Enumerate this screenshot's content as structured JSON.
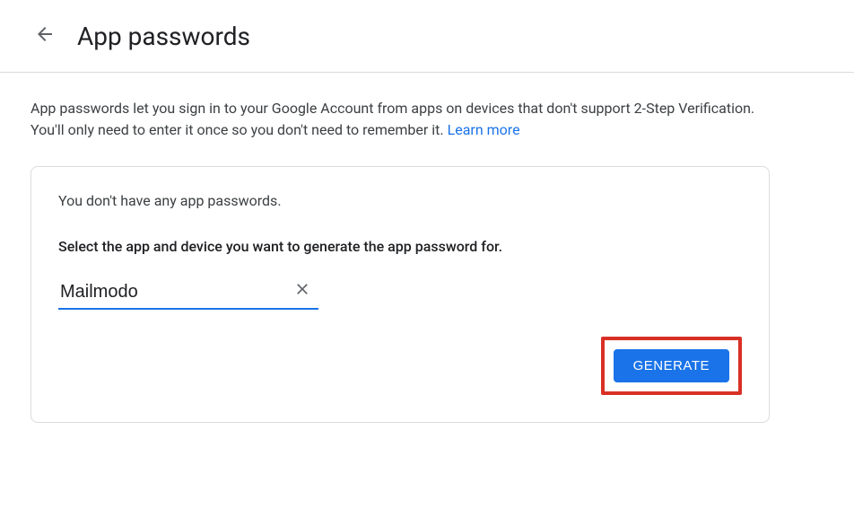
{
  "header": {
    "title": "App passwords"
  },
  "description": {
    "text": "App passwords let you sign in to your Google Account from apps on devices that don't support 2-Step Verification. You'll only need to enter it once so you don't need to remember it. ",
    "learn_more": "Learn more"
  },
  "card": {
    "empty_message": "You don't have any app passwords.",
    "select_message": "Select the app and device you want to generate the app password for.",
    "input_value": "Mailmodo",
    "generate_label": "GENERATE"
  }
}
